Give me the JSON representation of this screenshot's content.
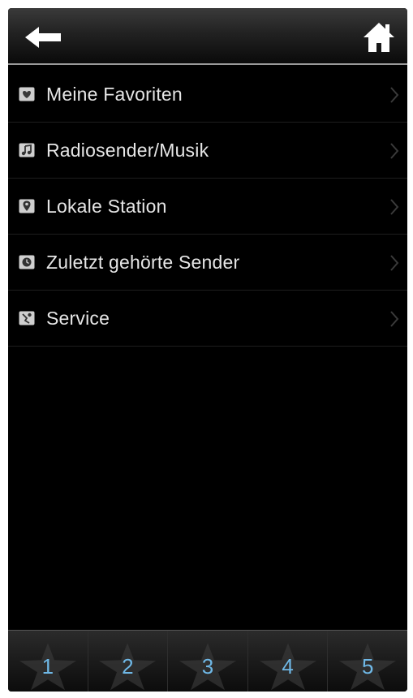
{
  "header": {
    "back_icon": "arrow-left-icon",
    "home_icon": "home-icon"
  },
  "menu": {
    "items": [
      {
        "label": "Meine Favoriten",
        "icon": "favorites-icon"
      },
      {
        "label": "Radiosender/Musik",
        "icon": "music-note-icon"
      },
      {
        "label": "Lokale Station",
        "icon": "location-pin-icon"
      },
      {
        "label": "Zuletzt gehörte Sender",
        "icon": "clock-icon"
      },
      {
        "label": "Service",
        "icon": "service-icon"
      }
    ]
  },
  "tabbar": {
    "tabs": [
      {
        "label": "1"
      },
      {
        "label": "2"
      },
      {
        "label": "3"
      },
      {
        "label": "4"
      },
      {
        "label": "5"
      }
    ]
  },
  "colors": {
    "background": "#000000",
    "text": "#e6e6e6",
    "tab_number": "#6fb8e6",
    "header_rule": "#9a9a9a"
  }
}
